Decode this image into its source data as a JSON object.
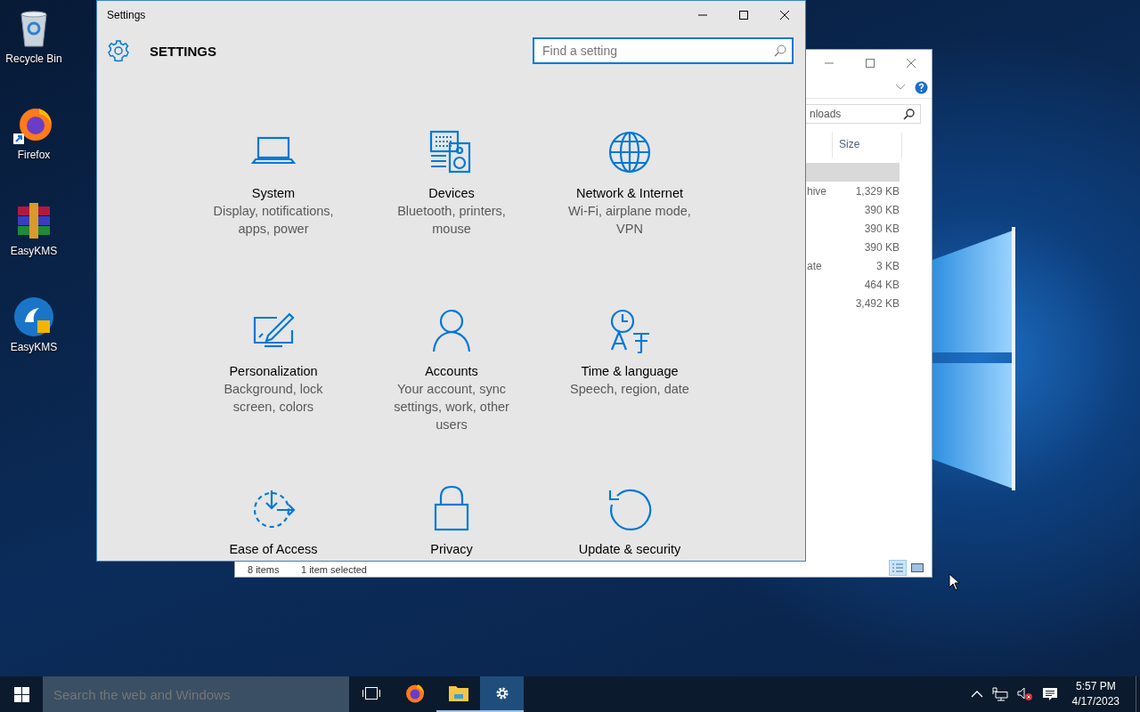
{
  "desktop_icons": [
    {
      "label": "Recycle Bin",
      "kind": "recycle-bin",
      "shortcut": false
    },
    {
      "label": "Firefox",
      "kind": "firefox",
      "shortcut": true
    },
    {
      "label": "EasyKMS",
      "kind": "archive",
      "shortcut": false
    },
    {
      "label": "EasyKMS",
      "kind": "easykms",
      "shortcut": false
    }
  ],
  "explorer_window": {
    "search_value": "nloads",
    "columns": [
      "Size"
    ],
    "rows": [
      {
        "selected": true
      },
      {
        "type": "hive",
        "size": "1,329 KB",
        "selected": false
      },
      {
        "size": "390 KB",
        "selected": false
      },
      {
        "size": "390 KB",
        "selected": false
      },
      {
        "size": "390 KB",
        "selected": false
      },
      {
        "type": "ate",
        "size": "3 KB",
        "selected": false
      },
      {
        "size": "464 KB",
        "selected": false
      },
      {
        "size": "3,492 KB",
        "selected": false
      }
    ],
    "status_count": "8 items",
    "status_selection": "1 item selected",
    "view_buttons": [
      {
        "kind": "details",
        "selected": true
      },
      {
        "kind": "large-icons",
        "selected": false
      }
    ]
  },
  "settings_window": {
    "title": "Settings",
    "heading": "SETTINGS",
    "search": {
      "placeholder": "Find a setting"
    },
    "categories": [
      {
        "kind": "system",
        "name": "System",
        "description": "Display, notifications, apps, power"
      },
      {
        "kind": "devices",
        "name": "Devices",
        "description": "Bluetooth, printers, mouse"
      },
      {
        "kind": "network",
        "name": "Network & Internet",
        "description": "Wi-Fi, airplane mode, VPN"
      },
      {
        "kind": "personalization",
        "name": "Personalization",
        "description": "Background, lock screen, colors"
      },
      {
        "kind": "accounts",
        "name": "Accounts",
        "description": "Your account, sync settings, work, other users"
      },
      {
        "kind": "time",
        "name": "Time & language",
        "description": "Speech, region, date"
      },
      {
        "kind": "ease",
        "name": "Ease of Access"
      },
      {
        "kind": "privacy",
        "name": "Privacy"
      },
      {
        "kind": "update",
        "name": "Update & security"
      }
    ]
  },
  "taskbar": {
    "search_placeholder": "Search the web and Windows",
    "apps": [
      {
        "kind": "task-view",
        "open": false,
        "active": false
      },
      {
        "kind": "firefox",
        "open": false,
        "active": false
      },
      {
        "kind": "file-explorer",
        "open": true,
        "active": false
      },
      {
        "kind": "settings",
        "open": true,
        "active": true
      }
    ],
    "tray": [
      {
        "kind": "chevron"
      },
      {
        "kind": "network"
      },
      {
        "kind": "volume-muted"
      },
      {
        "kind": "notifications"
      }
    ],
    "clock": {
      "time": "5:57 PM",
      "date": "4/17/2023"
    }
  }
}
